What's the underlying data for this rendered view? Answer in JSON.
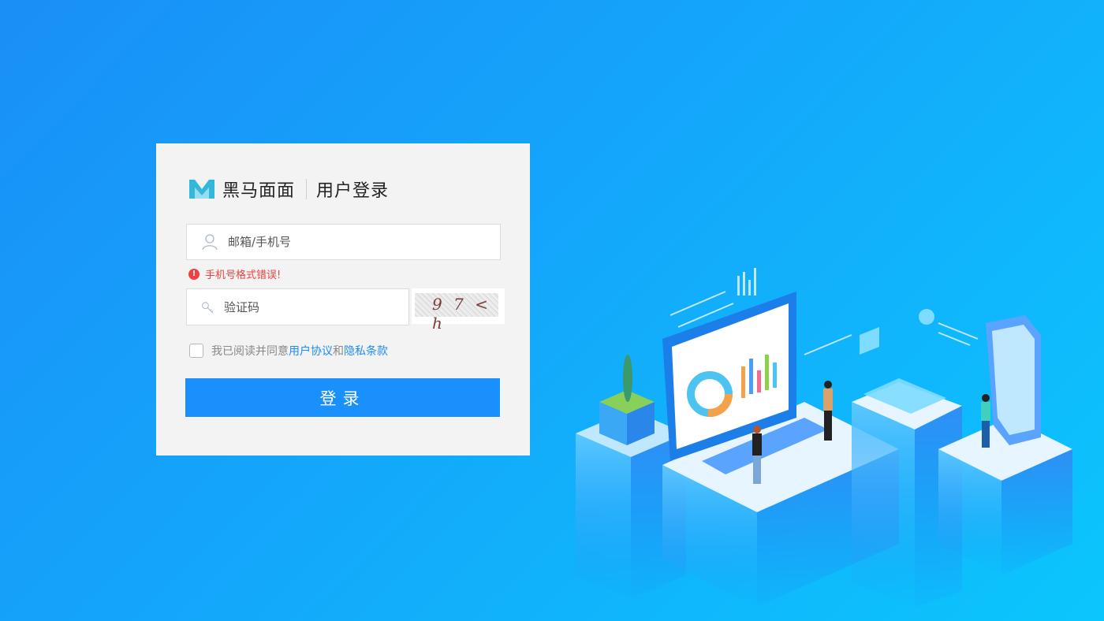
{
  "brand": {
    "name": "黑马面面",
    "subtitle": "用户登录"
  },
  "form": {
    "account_placeholder": "邮箱/手机号",
    "account_error": "手机号格式错误!",
    "code_placeholder": "验证码",
    "captcha_text": "9 7 < h",
    "agreement": {
      "prefix": "我已阅读并同意",
      "terms": "用户协议",
      "and": "和",
      "privacy": "隐私条款"
    },
    "submit_label": "登录"
  },
  "colors": {
    "accent": "#1a90fc",
    "error": "#f0413f",
    "link": "#1d8df5",
    "card": "#f3f3f3"
  }
}
